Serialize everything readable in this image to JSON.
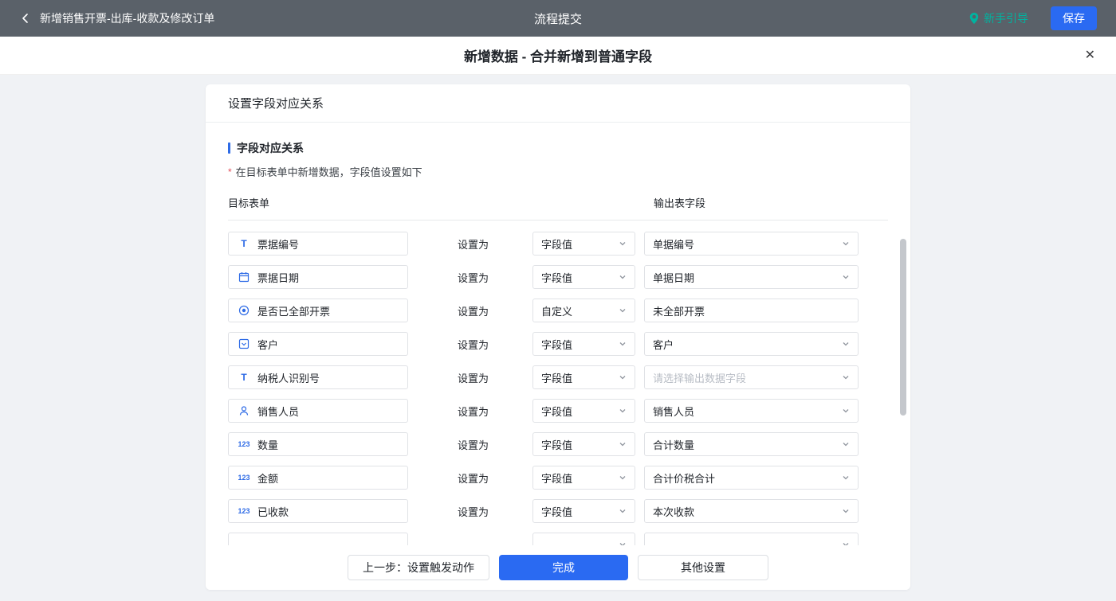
{
  "topbar": {
    "title": "新增销售开票-出库-收款及修改订单",
    "center_title": "流程提交",
    "guide_label": "新手引导",
    "save_label": "保存"
  },
  "modal": {
    "title": "新增数据 - 合并新增到普通字段",
    "close_icon": "✕"
  },
  "card": {
    "header_title": "设置字段对应关系",
    "section_title": "字段对应关系",
    "required_mark": "*",
    "hint": "在目标表单中新增数据，字段值设置如下",
    "columns": {
      "left": "目标表单",
      "right": "输出表字段"
    },
    "set_as": "设置为",
    "rows": [
      {
        "icon": "text",
        "field": "票据编号",
        "mode": "字段值",
        "output": "单据编号",
        "output_type": "select",
        "placeholder": false
      },
      {
        "icon": "date",
        "field": "票据日期",
        "mode": "字段值",
        "output": "单据日期",
        "output_type": "select",
        "placeholder": false
      },
      {
        "icon": "radio",
        "field": "是否已全部开票",
        "mode": "自定义",
        "output": "未全部开票",
        "output_type": "input",
        "placeholder": false
      },
      {
        "icon": "select",
        "field": "客户",
        "mode": "字段值",
        "output": "客户",
        "output_type": "select",
        "placeholder": false
      },
      {
        "icon": "text",
        "field": "纳税人识别号",
        "mode": "字段值",
        "output": "请选择输出数据字段",
        "output_type": "select",
        "placeholder": true
      },
      {
        "icon": "user",
        "field": "销售人员",
        "mode": "字段值",
        "output": "销售人员",
        "output_type": "select",
        "placeholder": false
      },
      {
        "icon": "number",
        "field": "数量",
        "mode": "字段值",
        "output": "合计数量",
        "output_type": "select",
        "placeholder": false
      },
      {
        "icon": "number",
        "field": "金额",
        "mode": "字段值",
        "output": "合计价税合计",
        "output_type": "select",
        "placeholder": false
      },
      {
        "icon": "number",
        "field": "已收款",
        "mode": "字段值",
        "output": "本次收款",
        "output_type": "select",
        "placeholder": false
      }
    ],
    "footer": {
      "prev_label": "上一步：设置触发动作",
      "done_label": "完成",
      "other_label": "其他设置"
    }
  },
  "colors": {
    "accent_blue": "#2e6be6",
    "primary_button": "#2a6af2",
    "topbar_bg": "#5a6169",
    "guide_teal": "#00b3a0",
    "required_red": "#e34d59"
  }
}
